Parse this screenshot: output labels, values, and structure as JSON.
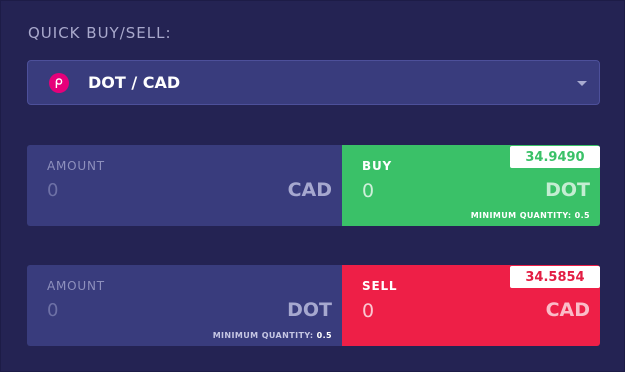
{
  "title": "QUICK BUY/SELL:",
  "pair_selector": {
    "label": "DOT / CAD",
    "icon": "polkadot-icon",
    "icon_color": "#e6007a"
  },
  "buy_row": {
    "amount_label": "AMOUNT",
    "amount_value": "0",
    "amount_unit": "CAD",
    "action_label": "BUY",
    "price": "34.9490",
    "result_value": "0",
    "result_unit": "DOT",
    "min_qty_label": "MINIMUM QUANTITY:",
    "min_qty_value": "0.5",
    "color": "#3ac168"
  },
  "sell_row": {
    "amount_label": "AMOUNT",
    "amount_value": "0",
    "amount_unit": "DOT",
    "min_qty_label": "MINIMUM QUANTITY:",
    "min_qty_value": "0.5",
    "action_label": "SELL",
    "price": "34.5854",
    "result_value": "0",
    "result_unit": "CAD",
    "color": "#ee1f47"
  }
}
